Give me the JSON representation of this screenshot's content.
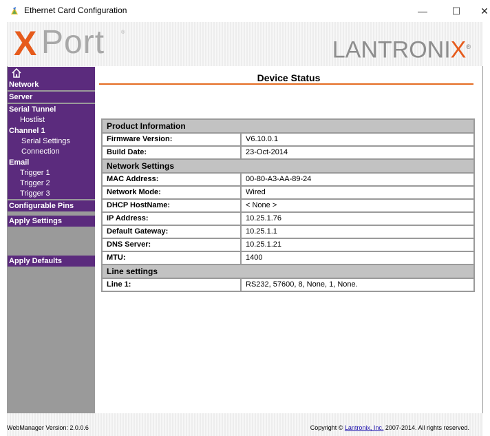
{
  "window": {
    "title": "Ethernet Card Configuration",
    "minimize": "—",
    "maximize": "☐",
    "close": "✕"
  },
  "header": {
    "logo_x": "X",
    "logo_port": "Port",
    "brand_prefix": "LANTRONI",
    "brand_x": "X",
    "brand_reg": "®",
    "accent_color": "#e65b1c"
  },
  "sidebar": {
    "home_icon": "home-icon",
    "items": [
      {
        "label": "Network"
      },
      {
        "label": "Server"
      },
      {
        "label": "Serial Tunnel"
      },
      {
        "label": "Hostlist"
      },
      {
        "label": "Channel 1"
      },
      {
        "label": "Serial Settings"
      },
      {
        "label": "Connection"
      },
      {
        "label": "Email"
      },
      {
        "label": "Trigger 1"
      },
      {
        "label": "Trigger 2"
      },
      {
        "label": "Trigger 3"
      },
      {
        "label": "Configurable Pins"
      },
      {
        "label": "Apply Settings"
      },
      {
        "label": "Apply Defaults"
      }
    ],
    "nav_color": "#5b2b7d"
  },
  "main": {
    "title": "Device Status",
    "sections": [
      {
        "heading": "Product Information",
        "rows": [
          {
            "label": "Firmware Version:",
            "value": "V6.10.0.1"
          },
          {
            "label": "Build Date:",
            "value": "23-Oct-2014"
          }
        ]
      },
      {
        "heading": "Network Settings",
        "rows": [
          {
            "label": "MAC Address:",
            "value": "00-80-A3-AA-89-24"
          },
          {
            "label": "Network Mode:",
            "value": "Wired"
          },
          {
            "label": "DHCP HostName:",
            "value": "< None >"
          },
          {
            "label": "IP Address:",
            "value": "10.25.1.76"
          },
          {
            "label": "Default Gateway:",
            "value": "10.25.1.1"
          },
          {
            "label": "DNS Server:",
            "value": "10.25.1.21"
          },
          {
            "label": "MTU:",
            "value": "1400"
          }
        ]
      },
      {
        "heading": "Line settings",
        "rows": [
          {
            "label": "Line 1:",
            "value": "RS232, 57600, 8, None, 1, None."
          }
        ]
      }
    ]
  },
  "footer": {
    "version": "WebManager Version: 2.0.0.6",
    "copyright_prefix": "Copyright © ",
    "copyright_link": "Lantronix, Inc.",
    "copyright_suffix": " 2007-2014. All rights reserved."
  }
}
